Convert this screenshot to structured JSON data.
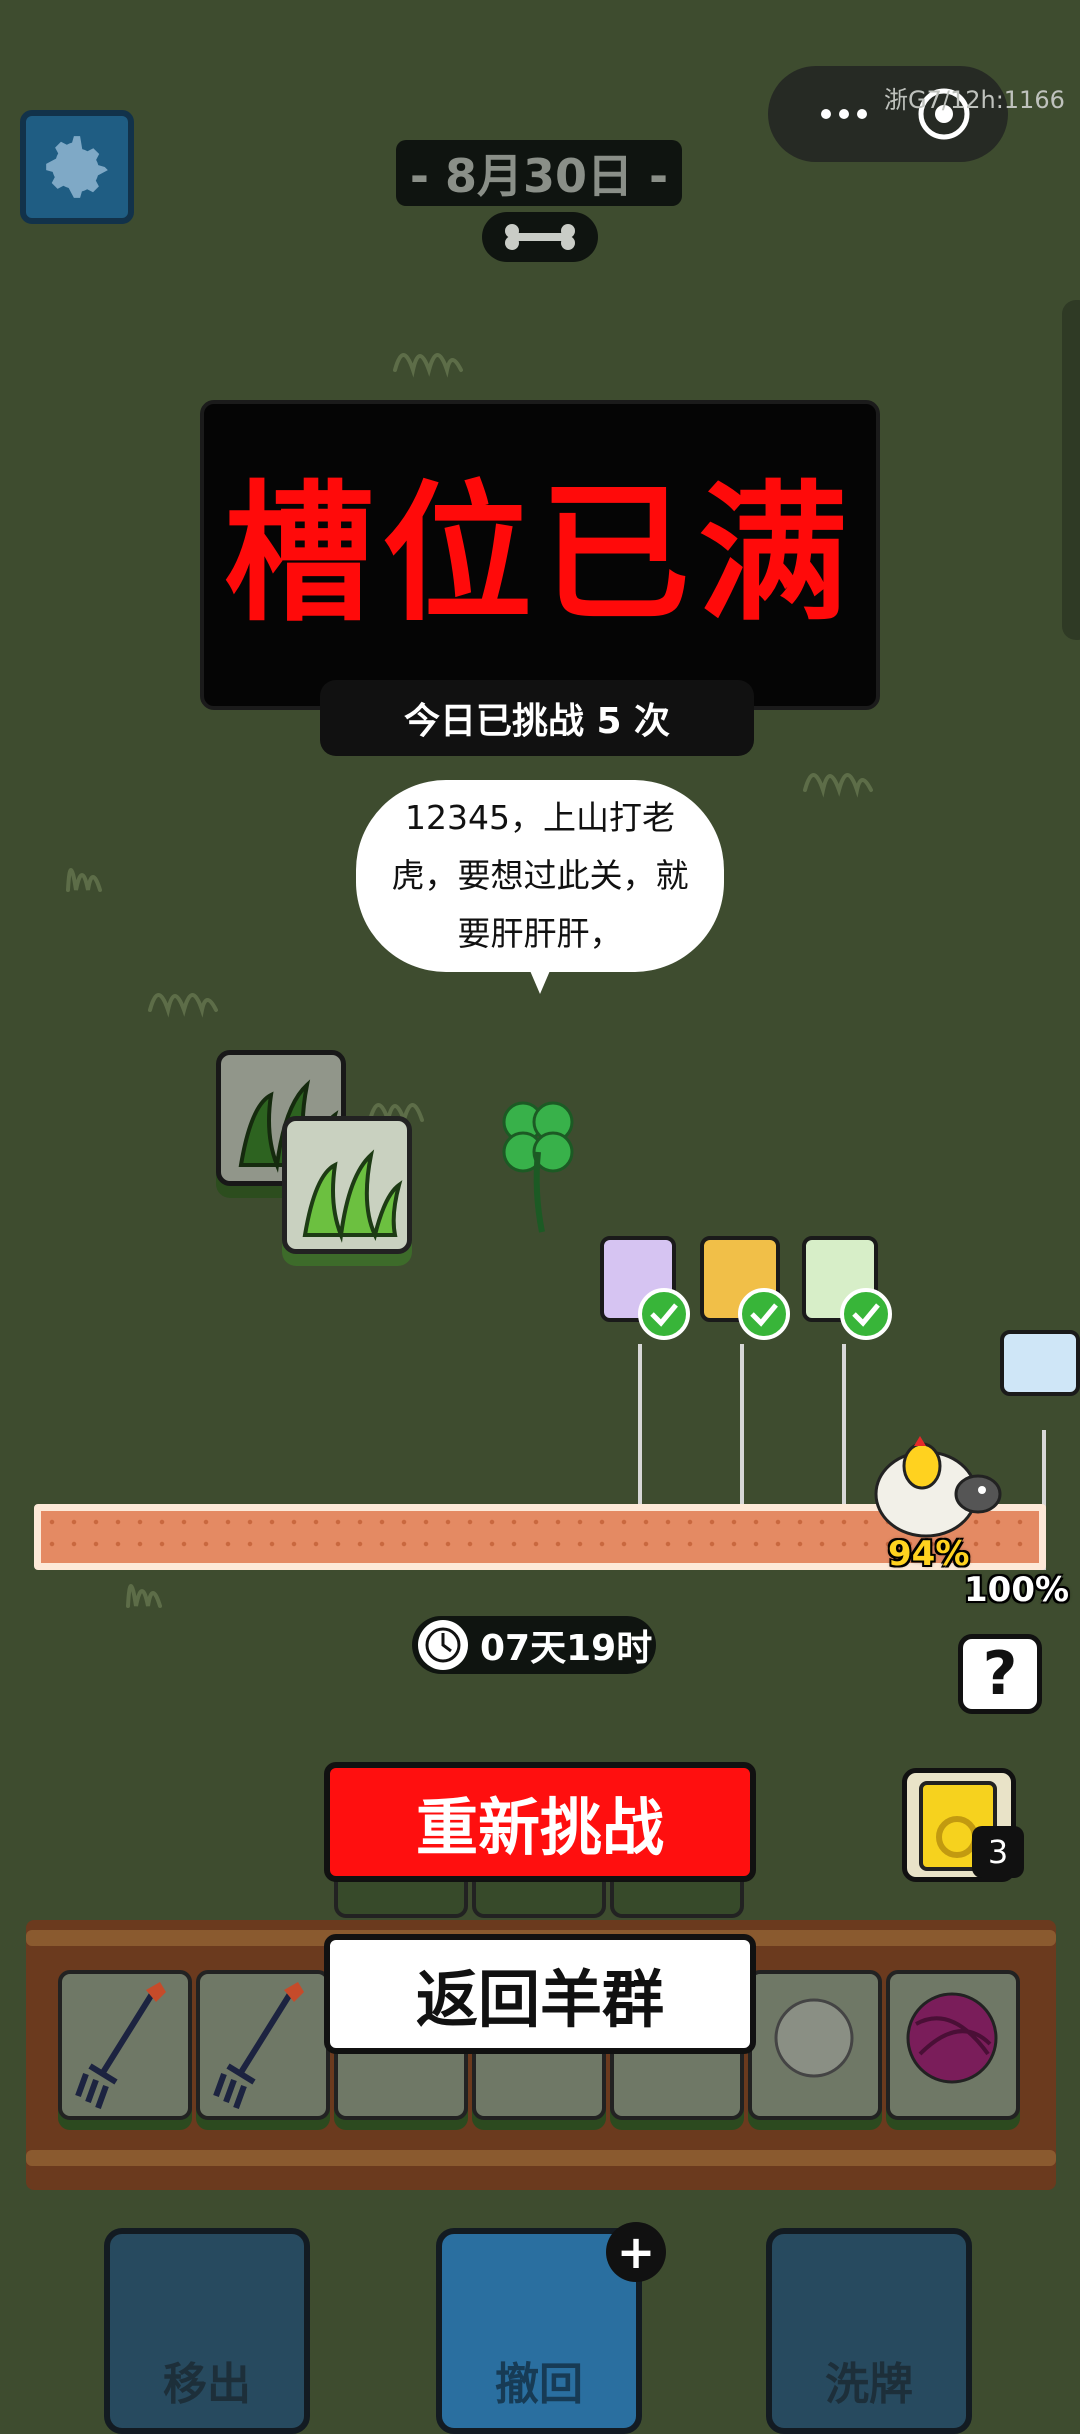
{
  "header": {
    "date": "- 8月30日 -",
    "watermark": "浙G7/12h:1166"
  },
  "result": {
    "title": "槽位已满",
    "challenge_count": "今日已挑战 5 次"
  },
  "speech_bubble": {
    "text": "12345，上山打老虎，要想过此关，就要肝肝肝，"
  },
  "progress": {
    "current_percent_label": "94%",
    "max_percent_label": "100%",
    "value": 0.94,
    "rewards": [
      {
        "icon": "purple-gift-icon",
        "claimed": true
      },
      {
        "icon": "golden-chest-icon",
        "claimed": true
      },
      {
        "icon": "teapot-icon",
        "claimed": true
      },
      {
        "icon": "envelope-icon",
        "claimed": false
      }
    ]
  },
  "timer": {
    "label": "07天19时"
  },
  "buttons": {
    "retry": "重新挑战",
    "back": "返回羊群",
    "help": "?"
  },
  "item_card": {
    "count": "3"
  },
  "bottom_bar": {
    "move_out": "移出",
    "undo": "撤回",
    "shuffle": "洗牌"
  },
  "colors": {
    "background": "#3e4c2f",
    "title_red": "#ff0a0a",
    "progress_fill": "#e48a63",
    "check_green": "#38b539"
  }
}
